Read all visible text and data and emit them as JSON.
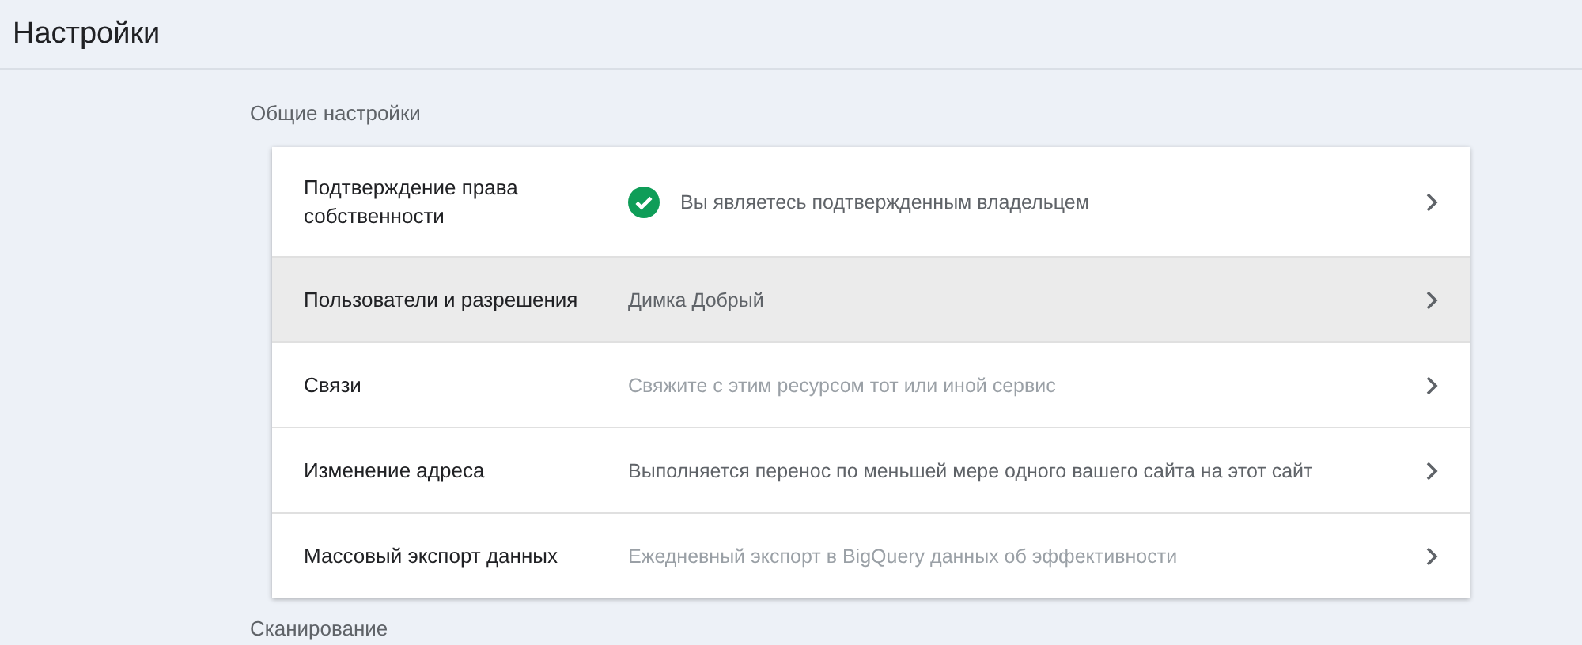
{
  "header": {
    "title": "Настройки"
  },
  "sections": [
    {
      "title": "Общие настройки",
      "rows": [
        {
          "label": "Подтверждение права собственности",
          "value": "Вы являетесь подтвержденным владельцем",
          "kind": "verified",
          "selected": false
        },
        {
          "label": "Пользователи и разрешения",
          "value": "Димка Добрый",
          "kind": "status",
          "selected": true
        },
        {
          "label": "Связи",
          "value": "Свяжите с этим ресурсом тот или иной сервис",
          "kind": "hint",
          "selected": false
        },
        {
          "label": "Изменение адреса",
          "value": "Выполняется перенос по меньшей мере одного вашего сайта на этот сайт",
          "kind": "status",
          "selected": false
        },
        {
          "label": "Массовый экспорт данных",
          "value": "Ежедневный экспорт в BigQuery данных об эффективности",
          "kind": "hint",
          "selected": false
        }
      ]
    },
    {
      "title": "Сканирование"
    }
  ]
}
